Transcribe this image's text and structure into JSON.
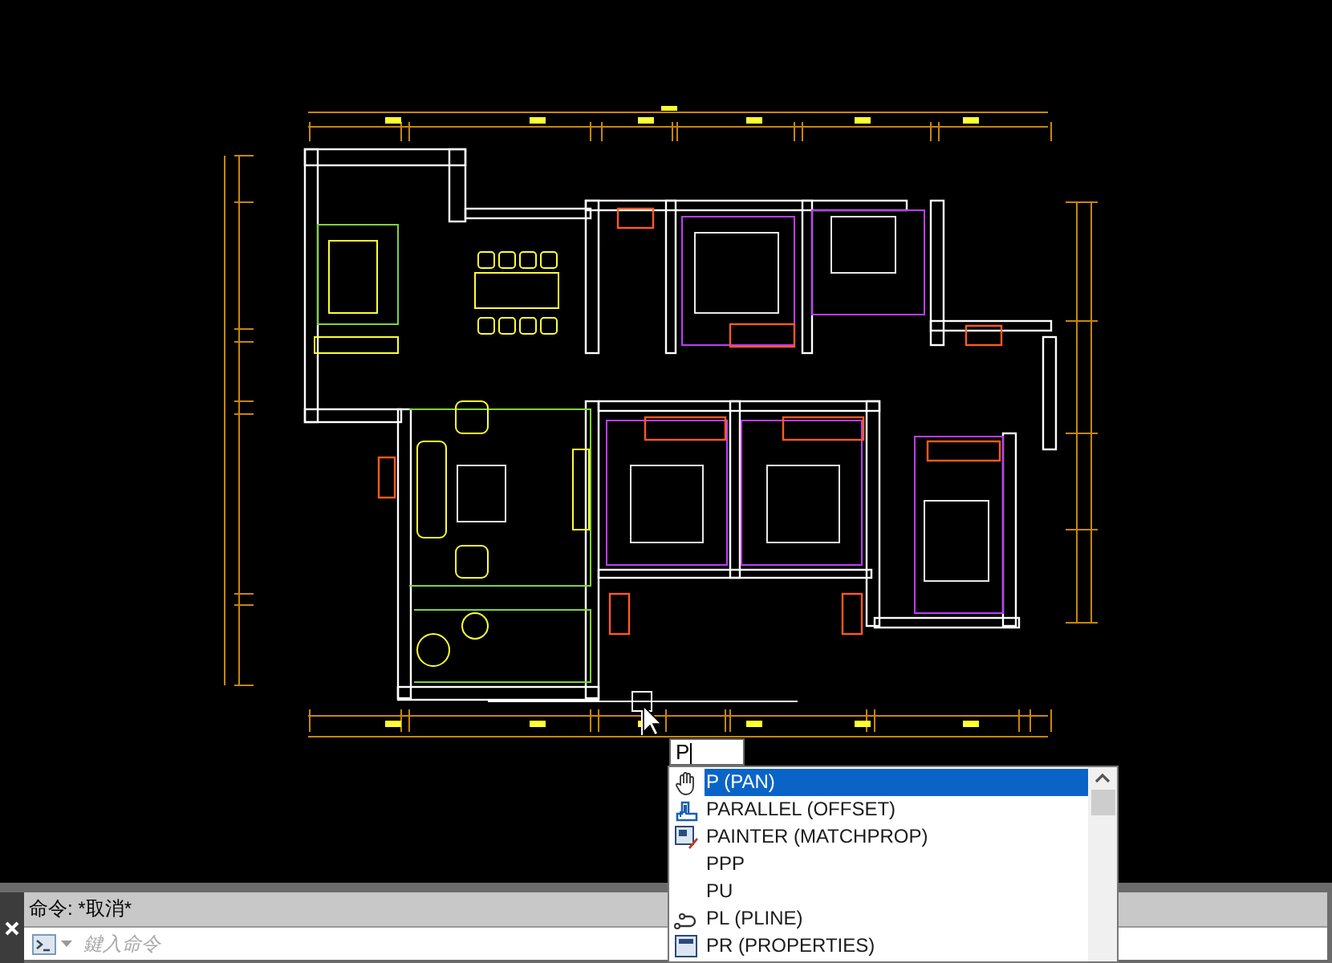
{
  "command_input": {
    "value": "P"
  },
  "suggestions": [
    {
      "label": "P (PAN)",
      "kind": "hand",
      "selected": true
    },
    {
      "label": "PARALLEL (OFFSET)",
      "kind": "offset",
      "selected": false
    },
    {
      "label": "PAINTER (MATCHPROP)",
      "kind": "painter",
      "selected": false
    },
    {
      "label": "PPP",
      "kind": "none",
      "selected": false
    },
    {
      "label": "PU",
      "kind": "none",
      "selected": false
    },
    {
      "label": "PL (PLINE)",
      "kind": "pline",
      "selected": false
    },
    {
      "label": "PR (PROPERTIES)",
      "kind": "properties",
      "selected": false
    }
  ],
  "command_line": {
    "history": "命令: *取消*",
    "placeholder": "鍵入命令"
  }
}
